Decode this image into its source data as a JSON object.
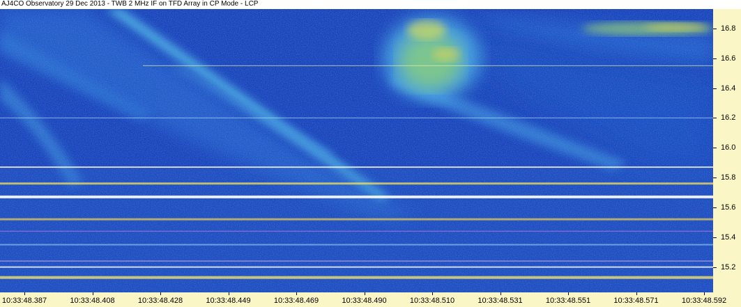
{
  "window": {
    "title": "AJ4CO Observatory 29 Dec 2013 - TWB 2 MHz IF on TFD Array in CP Mode - LCP"
  },
  "chart_data": {
    "type": "heatmap",
    "title": "AJ4CO Observatory 29 Dec 2013 - TWB 2 MHz IF on TFD Array in CP Mode - LCP",
    "xlabel": "",
    "ylabel": "",
    "x_tick_labels": [
      "10:33:48.387",
      "10:33:48.408",
      "10:33:48.428",
      "10:33:48.449",
      "10:33:48.469",
      "10:33:48.490",
      "10:33:48.510",
      "10:33:48.531",
      "10:33:48.551",
      "10:33:48.571",
      "10:33:48.592"
    ],
    "y_tick_labels": [
      "16.8",
      "16.6",
      "16.4",
      "16.2",
      "16.0",
      "15.8",
      "15.6",
      "15.4",
      "15.2"
    ],
    "y_ticks": [
      16.8,
      16.6,
      16.4,
      16.2,
      16.0,
      15.8,
      15.6,
      15.4,
      15.2
    ],
    "ylim": [
      15.03,
      16.93
    ],
    "colormap": [
      "#1a45b8",
      "#2a6fd6",
      "#3fa0e6",
      "#62d0d8",
      "#a8e060",
      "#f0e040",
      "#f07a20",
      "#d02020"
    ],
    "background_color": "#1a45b8",
    "axis_panel_color": "#fbf6c6",
    "grid": false,
    "interference_lines_mhz": [
      16.55,
      16.2,
      15.87,
      15.76,
      15.67,
      15.52,
      15.44,
      15.35,
      15.24,
      15.2,
      15.13
    ],
    "features": [
      {
        "kind": "drifting burst",
        "description": "bright diagonal emission band"
      },
      {
        "kind": "emission patch",
        "description": "bright yellow-green patch near top center"
      },
      {
        "kind": "emission patch",
        "description": "bright band near top right"
      }
    ]
  }
}
